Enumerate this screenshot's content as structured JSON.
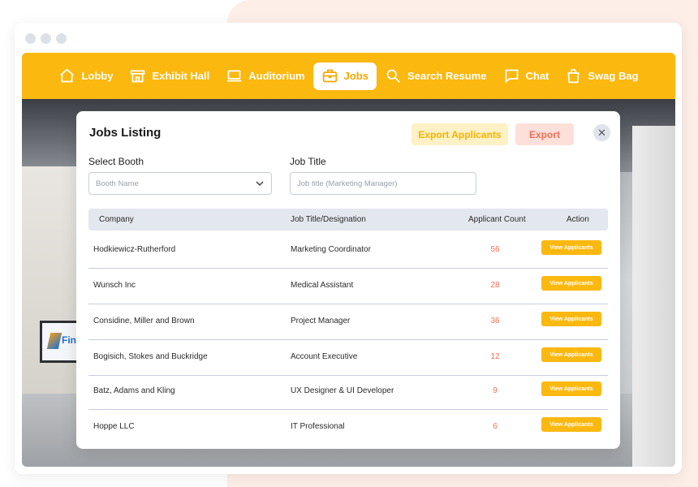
{
  "nav": [
    {
      "label": "Lobby",
      "icon": "home-icon"
    },
    {
      "label": "Exhibit Hall",
      "icon": "store-icon"
    },
    {
      "label": "Auditorium",
      "icon": "laptop-icon"
    },
    {
      "label": "Jobs",
      "icon": "briefcase-icon",
      "active": true
    },
    {
      "label": "Search Resume",
      "icon": "search-icon"
    },
    {
      "label": "Chat",
      "icon": "chat-icon"
    },
    {
      "label": "Swag Bag",
      "icon": "bag-icon"
    }
  ],
  "modal": {
    "title": "Jobs Listing",
    "export_applicants_label": "Export Applicants",
    "export_label": "Export",
    "close_symbol": "✕"
  },
  "filters": {
    "booth_label": "Select Booth",
    "booth_placeholder": "Booth Name",
    "job_title_label": "Job Title",
    "job_title_placeholder": "Job title (Marketing Manager)"
  },
  "table": {
    "headers": [
      "Company",
      "Job Title/Designation",
      "Applicant Count",
      "Action"
    ],
    "rows": [
      {
        "company": "Hodkiewicz-Rutherford",
        "title": "Marketing Coordinator",
        "count": "56",
        "action": "View Applicants"
      },
      {
        "company": "Wunsch Inc",
        "title": "Medical Assistant",
        "count": "28",
        "action": "View Applicants"
      },
      {
        "company": "Considine, Miller and Brown",
        "title": "Project Manager",
        "count": "36",
        "action": "View Applicants"
      },
      {
        "company": "Bogisich, Stokes and Buckridge",
        "title": "Account Executive",
        "count": "12",
        "action": "View Applicants"
      },
      {
        "company": "Batz, Adams and Kling",
        "title": "UX Designer & UI Developer",
        "count": "9",
        "action": "View Applicants"
      },
      {
        "company": "Hoppe LLC",
        "title": "IT Professional",
        "count": "6",
        "action": "View Applicants"
      }
    ]
  },
  "background": {
    "screen_logo_text": "Fin"
  },
  "colors": {
    "accent": "#fbb80f",
    "count": "#ef6f57",
    "export": "#ef6f57"
  }
}
